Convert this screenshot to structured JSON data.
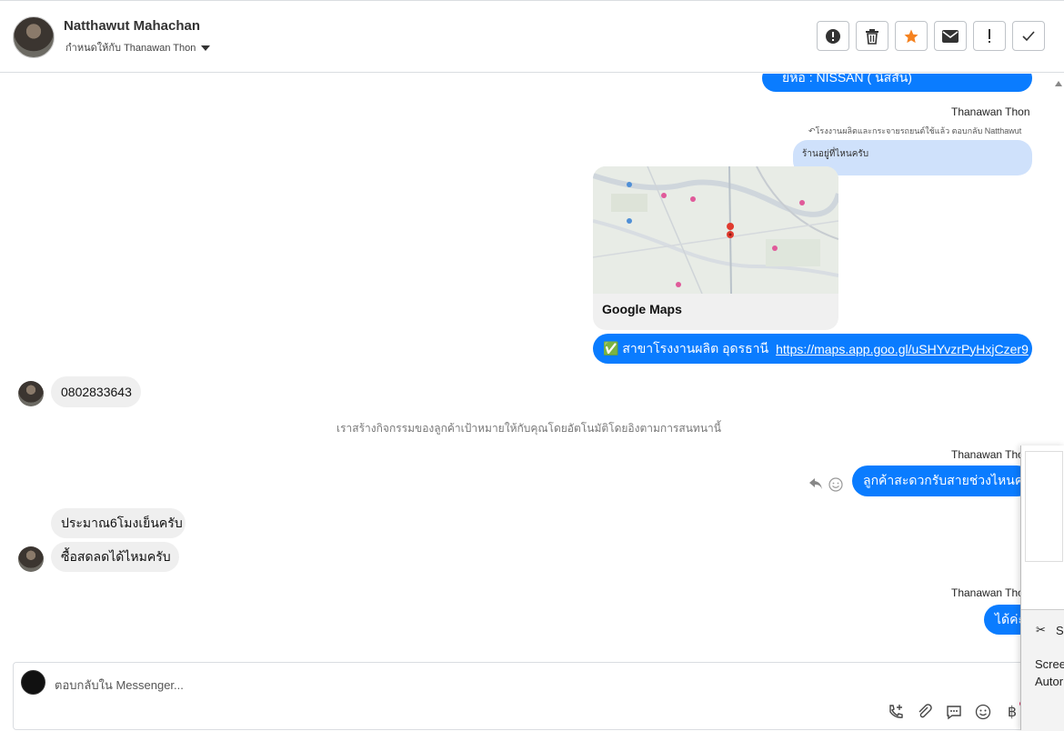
{
  "header": {
    "name": "Natthawut Mahachan",
    "assigned": "กำหนดให้กับ Thanawan Thon"
  },
  "messages": {
    "top_cut_bubble": "ยี่ห้อ : NISSAN ( นิสสัน)",
    "sender_1": "Thanawan Thon",
    "reply_tag": "โรงงานผลิตและกระจายรถยนต์ใช้แล้ว ตอบกลับ Natthawut",
    "quoted_text": "ร้านอยู่ที่ไหนครับ",
    "map_title": "Google Maps",
    "location_prefix": "✅ สาขาโรงงานผลิต อุดรธานี",
    "location_link": "https://maps.app.goo.gl/uSHYvzrPyHxjCzer9",
    "phone": "0802833643",
    "system_note": "เราสร้างกิจกรรมของลูกค้าเป้าหมายให้กับคุณโดยอัตโนมัติโดยอิงตามการสนทนานี้",
    "sender_2": "Thanawan Thon",
    "outgoing_2": "ลูกค้าสะดวกรับสายช่วงไหนคะ",
    "incoming_1": "ประมาณ6โมงเย็นครับ",
    "incoming_2": "ซื้อสดลดได้ไหมครับ",
    "sender_3": "Thanawan Thon",
    "outgoing_3": "ได้ค่ะ"
  },
  "composer": {
    "placeholder_prefix": "ตอบกลับใน",
    "placeholder_app": "Messenger..."
  },
  "overlay": {
    "line1": "S",
    "line2": "Scree",
    "line3": "Autor"
  },
  "colors": {
    "outgoing_bubble": "#0a7cff",
    "incoming_bubble": "#efefef",
    "accent_star": "#f5821f"
  }
}
